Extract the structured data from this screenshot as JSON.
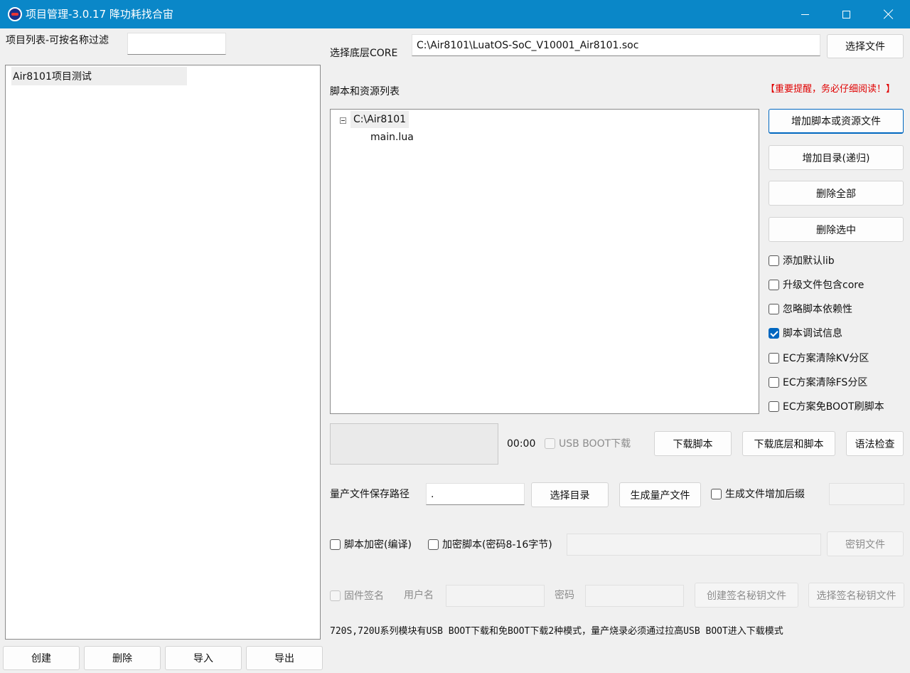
{
  "window": {
    "title": "项目管理-3.0.17 降功耗找合宙"
  },
  "left": {
    "filter_label": "项目列表-可按名称过滤",
    "filter_value": "",
    "projects": [
      "Air8101项目测试"
    ],
    "buttons": {
      "create": "创建",
      "delete": "删除",
      "import": "导入",
      "export": "导出"
    }
  },
  "core": {
    "label": "选择底层CORE",
    "path": "C:\\Air8101\\LuatOS-SoC_V10001_Air8101.soc",
    "choose_button": "选择文件"
  },
  "scripts": {
    "label": "脚本和资源列表",
    "notice": "【重要提醒，务必仔细阅读！】",
    "tree": {
      "root": "C:\\Air8101",
      "children": [
        "main.lua"
      ]
    },
    "buttons": {
      "add_file": "增加脚本或资源文件",
      "add_dir": "增加目录(递归)",
      "delete_all": "删除全部",
      "delete_selected": "删除选中"
    },
    "options": [
      {
        "label": "添加默认lib",
        "checked": false
      },
      {
        "label": "升级文件包含core",
        "checked": false
      },
      {
        "label": "忽略脚本依赖性",
        "checked": false
      },
      {
        "label": "脚本调试信息",
        "checked": true
      },
      {
        "label": "EC方案清除KV分区",
        "checked": false
      },
      {
        "label": "EC方案清除FS分区",
        "checked": false
      },
      {
        "label": "EC方案免BOOT刷脚本",
        "checked": false
      }
    ]
  },
  "download": {
    "timer": "00:00",
    "usb_boot_label": "USB BOOT下载",
    "download_script": "下载脚本",
    "download_core_script": "下载底层和脚本",
    "syntax_check": "语法检查"
  },
  "mass": {
    "path_label": "量产文件保存路径",
    "path_value": ".",
    "choose_dir": "选择目录",
    "generate": "生成量产文件",
    "suffix_label": "生成文件增加后缀",
    "suffix_value": ""
  },
  "encrypt": {
    "compile_label": "脚本加密(编译)",
    "encrypt_label": "加密脚本(密码8-16字节)",
    "password_value": "",
    "key_file": "密钥文件"
  },
  "sign": {
    "firmware_sign": "固件签名",
    "user_label": "用户名",
    "user_value": "",
    "pass_label": "密码",
    "pass_value": "",
    "create_key": "创建签名秘钥文件",
    "choose_key": "选择签名秘钥文件"
  },
  "footer_note": "720S,720U系列模块有USB BOOT下载和免BOOT下载2种模式，量产烧录必须通过拉高USB BOOT进入下载模式"
}
